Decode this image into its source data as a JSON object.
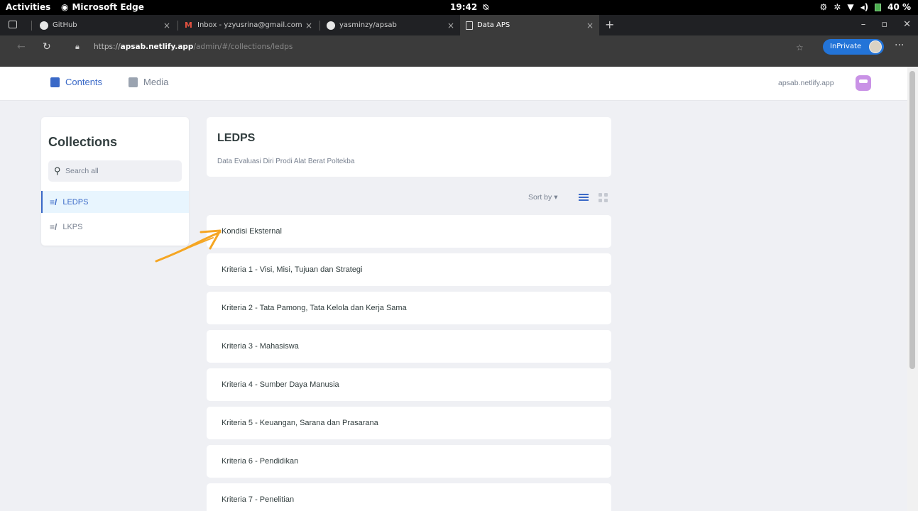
{
  "topbar": {
    "activities": "Activities",
    "app": "Microsoft Edge",
    "clock": "19:42",
    "battery": "40 %"
  },
  "tabs": [
    {
      "title": "GitHub",
      "icon": "github-icon"
    },
    {
      "title": "Inbox - yzyusrina@gmail.com",
      "icon": "gmail-icon"
    },
    {
      "title": "yasminzy/apsab",
      "icon": "github-icon"
    },
    {
      "title": "Data APS",
      "icon": "document-icon",
      "active": true
    }
  ],
  "address": {
    "scheme": "https://",
    "host": "apsab.netlify.app",
    "path": "/admin/#/collections/ledps",
    "inprivate": "InPrivate"
  },
  "header": {
    "contents": "Contents",
    "media": "Media",
    "site": "apsab.netlify.app"
  },
  "sidebar": {
    "title": "Collections",
    "search_placeholder": "Search all",
    "collections": [
      {
        "label": "LEDPS",
        "active": true
      },
      {
        "label": "LKPS",
        "active": false
      }
    ]
  },
  "collection": {
    "title": "LEDPS",
    "description": "Data Evaluasi Diri Prodi Alat Berat Poltekba",
    "sort_label": "Sort by"
  },
  "entries": [
    "Kondisi Eksternal",
    "Kriteria 1 - Visi, Misi, Tujuan dan Strategi",
    "Kriteria 2 - Tata Pamong, Tata Kelola dan Kerja Sama",
    "Kriteria 3 - Mahasiswa",
    "Kriteria 4 - Sumber Daya Manusia",
    "Kriteria 5 - Keuangan, Sarana dan Prasarana",
    "Kriteria 6 - Pendidikan",
    "Kriteria 7 - Penelitian"
  ],
  "colors": {
    "accent": "#3a69c7",
    "annotation_arrow": "#f5a623"
  }
}
